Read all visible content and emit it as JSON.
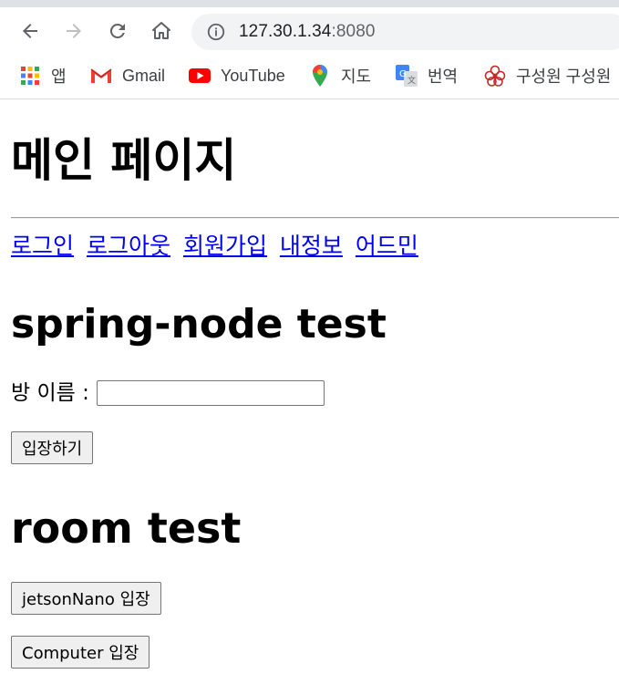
{
  "browser": {
    "url_host": "127.30.1.34",
    "url_port": ":8080",
    "bookmarks": [
      {
        "label": "앱",
        "icon": "apps-grid-icon"
      },
      {
        "label": "Gmail",
        "icon": "gmail-icon"
      },
      {
        "label": "YouTube",
        "icon": "youtube-icon"
      },
      {
        "label": "지도",
        "icon": "maps-pin-icon"
      },
      {
        "label": "번역",
        "icon": "translate-icon"
      },
      {
        "label": "구성원 구성원",
        "icon": "org-logo-icon"
      }
    ]
  },
  "page": {
    "title": "메인 페이지",
    "nav_links": [
      "로그인",
      "로그아웃",
      "회원가입",
      "내정보",
      "어드민"
    ],
    "spring_heading": "spring-node test",
    "room_label": "방 이름 :",
    "room_input_value": "",
    "enter_button": "입장하기",
    "room_heading": "room test",
    "jetson_button": "jetsonNano 입장",
    "computer_button": "Computer 입장"
  },
  "colors": {
    "link": "#0000ee",
    "toolbar_bg": "#ffffff",
    "omnibox_bg": "#f1f3f4"
  }
}
